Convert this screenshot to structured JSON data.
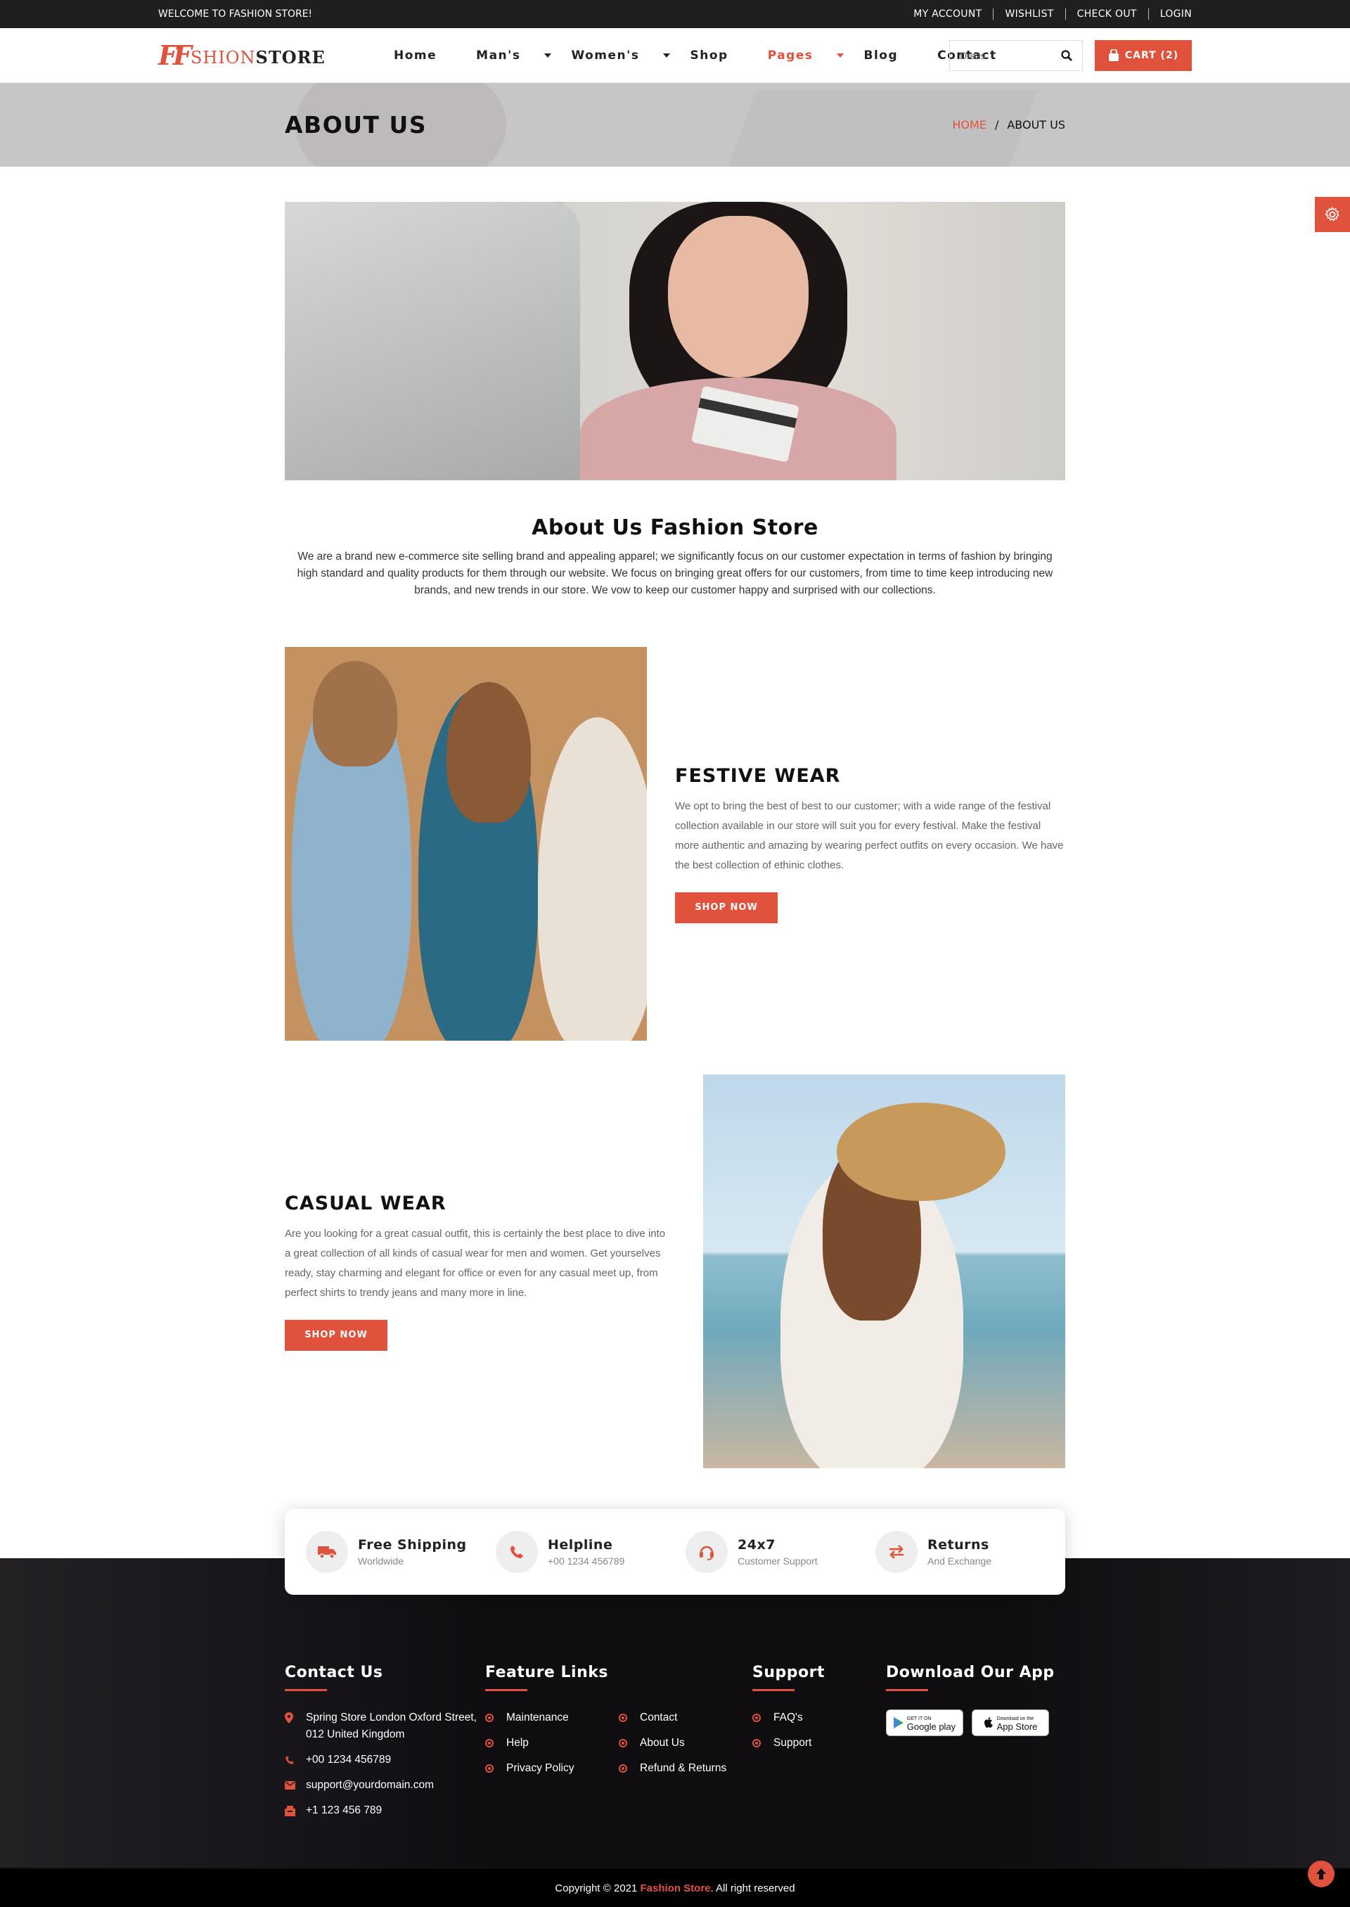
{
  "topbar": {
    "welcome": "WELCOME TO FASHION STORE!",
    "links": [
      "MY ACCOUNT",
      "WISHLIST",
      "CHECK OUT",
      "LOGIN"
    ]
  },
  "header": {
    "logo_mark": "FF",
    "logo_part1": "SHION",
    "logo_part2": "STORE",
    "nav": [
      {
        "label": "Home",
        "dropdown": false,
        "active": false
      },
      {
        "label": "Man's",
        "dropdown": true,
        "active": false
      },
      {
        "label": "Women's",
        "dropdown": true,
        "active": false
      },
      {
        "label": "Shop",
        "dropdown": false,
        "active": false
      },
      {
        "label": "Pages",
        "dropdown": true,
        "active": true
      },
      {
        "label": "Blog",
        "dropdown": false,
        "active": false
      },
      {
        "label": "Contact",
        "dropdown": false,
        "active": false
      }
    ],
    "search_placeholder": "Dress",
    "cart_label": "CART (2)"
  },
  "banner": {
    "title": "ABOUT US",
    "breadcrumb_home": "HOME",
    "breadcrumb_sep": "/",
    "breadcrumb_current": "ABOUT US"
  },
  "about": {
    "heading": "About Us Fashion Store",
    "text": "We are a brand new e-commerce site selling brand and appealing apparel; we significantly focus on our customer expectation in terms of fashion by bringing high standard and quality products for them through our website. We focus on bringing great offers for our customers, from time to time keep introducing new brands, and new trends in our store. We vow to keep our customer happy and surprised with our collections."
  },
  "festive": {
    "heading": "FESTIVE WEAR",
    "text": "We opt to bring the best of best to our customer; with a wide range of the festival collection available in our store will suit you for every festival. Make the festival more authentic and amazing by wearing perfect outfits on every occasion. We have the best collection of ethinic clothes.",
    "button": "SHOP NOW"
  },
  "casual": {
    "heading": "CASUAL WEAR",
    "text": "Are you looking for a great casual outfit, this is certainly the best place to dive into a great collection of all kinds of casual wear for men and women. Get yourselves ready, stay charming and elegant for office or even for any casual meet up, from perfect shirts to trendy jeans and many more in line.",
    "button": "SHOP NOW"
  },
  "features": [
    {
      "title": "Free Shipping",
      "subtitle": "Worldwide",
      "icon": "truck-icon"
    },
    {
      "title": "Helpline",
      "subtitle": "+00 1234 456789",
      "icon": "phone-icon"
    },
    {
      "title": "24x7",
      "subtitle": "Customer Support",
      "icon": "headset-icon"
    },
    {
      "title": "Returns",
      "subtitle": "And Exchange",
      "icon": "exchange-icon"
    }
  ],
  "footer": {
    "contact": {
      "heading": "Contact Us",
      "address": "Spring Store London Oxford Street, 012 United Kingdom",
      "phone": "+00 1234 456789",
      "email": "support@yourdomain.com",
      "fax": "+1 123 456 789"
    },
    "feature_links": {
      "heading": "Feature Links",
      "col1": [
        "Maintenance",
        "Help",
        "Privacy Policy"
      ],
      "col2": [
        "Contact",
        "About Us",
        "Refund & Returns"
      ]
    },
    "support": {
      "heading": "Support",
      "items": [
        "FAQ's",
        "Support"
      ]
    },
    "app": {
      "heading": "Download Our App",
      "google_small": "GET IT ON",
      "google": "Google play",
      "apple_small": "Download on the",
      "apple": "App Store"
    },
    "copyright_pre": "Copyright © 2021 ",
    "copyright_brand": "Fashion Store",
    "copyright_post": ". All right reserved"
  },
  "colors": {
    "accent": "#e0523c",
    "dark": "#1f1f1f"
  }
}
